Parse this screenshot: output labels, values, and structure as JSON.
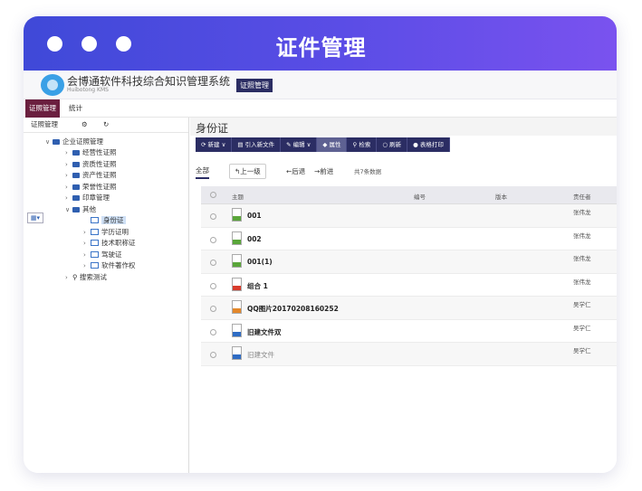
{
  "window": {
    "title": "证件管理",
    "dots": [
      "dot",
      "dot",
      "dot"
    ],
    "colors": {
      "gradient_start": "#3f49d8",
      "gradient_end": "#7a52ef"
    }
  },
  "app": {
    "name": "会博通软件科技综合知识管理系统",
    "subtitle": "Huibotong KMS",
    "badge": "证照管理"
  },
  "menu": {
    "items": [
      "证照管理",
      "统计"
    ],
    "active": "证照管理",
    "active_color": "#6b1f3f"
  },
  "sidebar": {
    "tabs": {
      "label": "证照管理",
      "gear_icon": "gear-icon",
      "refresh_icon": "refresh-icon"
    },
    "tree": {
      "root": "企业证照管理",
      "children": [
        "经营性证照",
        "资质性证照",
        "资产性证照",
        "荣誉性证照",
        "印章管理",
        "其他"
      ],
      "other_children": [
        "身份证",
        "学历证明",
        "技术职称证",
        "驾驶证",
        "软件著作权"
      ],
      "search": "搜索测试",
      "selected": "身份证"
    }
  },
  "main": {
    "title": "身份证",
    "toolbar": [
      {
        "label": "新建",
        "icon": "new-icon",
        "dropdown": true
      },
      {
        "label": "引入新文件",
        "icon": "import-icon"
      },
      {
        "label": "编辑",
        "icon": "edit-icon",
        "dropdown": true
      },
      {
        "label": "属性",
        "icon": "tag-icon"
      },
      {
        "label": "检索",
        "icon": "search-icon"
      },
      {
        "label": "刷新",
        "icon": "refresh-icon"
      },
      {
        "label": "表格打印",
        "icon": "print-icon"
      }
    ],
    "nav": {
      "all": "全部",
      "up": "上一级",
      "back": "后退",
      "forward": "前进",
      "count": "共7条数据"
    },
    "table": {
      "headers": {
        "subject": "主题",
        "number": "编号",
        "version": "版本",
        "owner": "责任者"
      },
      "rows": [
        {
          "name": "001",
          "type": "JPG",
          "owner": "张伟龙"
        },
        {
          "name": "002",
          "type": "JPG",
          "owner": "张伟龙"
        },
        {
          "name": "001(1)",
          "type": "JPG",
          "owner": "张伟龙"
        },
        {
          "name": "组合 1",
          "type": "PDF",
          "owner": "张伟龙"
        },
        {
          "name": "QQ图片20170208160252",
          "type": "PNG",
          "owner": "吴学仁"
        },
        {
          "name": "旧建文件双",
          "type": "DOC",
          "owner": "吴学仁"
        },
        {
          "name": "旧建文件",
          "type": "HTML",
          "owner": "吴学仁"
        }
      ],
      "type_colors": {
        "JPG": "#5aa63a",
        "PDF": "#d83b2c",
        "PNG": "#e3872a",
        "DOC": "#2f6cc4",
        "HTML": "#2f6cc4"
      }
    }
  }
}
